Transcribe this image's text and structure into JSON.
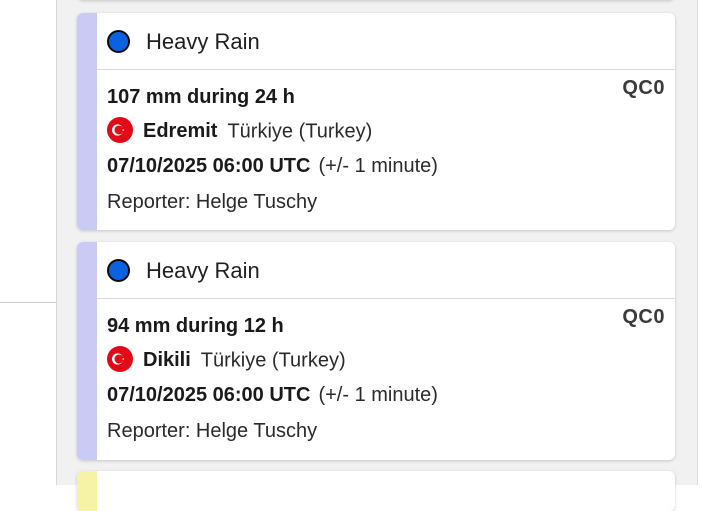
{
  "colors": {
    "stripe_rain": "#c9cbf5",
    "stripe_yellow": "#f7f3a6",
    "stripe_red": "#f2a5a5",
    "rain_dot": "#0b62e0",
    "flag_red": "#e30a17"
  },
  "reports": [
    {
      "type_icon": "blue-circle-icon",
      "type": "Heavy Rain",
      "amount": "107 mm during 24 h",
      "qc": "QC0",
      "flag_icon": "turkey-flag-icon",
      "place": "Edremit",
      "country": "Türkiye (Turkey)",
      "time": "07/10/2025 06:00 UTC",
      "time_uncertainty": "(+/- 1 minute)",
      "reporter": "Reporter: Helge Tuschy"
    },
    {
      "type_icon": "blue-circle-icon",
      "type": "Heavy Rain",
      "amount": "94 mm during 12 h",
      "qc": "QC0",
      "flag_icon": "turkey-flag-icon",
      "place": "Dikili",
      "country": "Türkiye (Turkey)",
      "time": "07/10/2025 06:00 UTC",
      "time_uncertainty": "(+/- 1 minute)",
      "reporter": "Reporter: Helge Tuschy"
    }
  ]
}
